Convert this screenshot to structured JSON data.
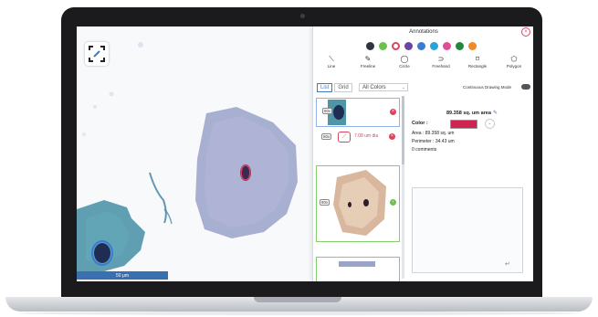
{
  "panel": {
    "title": "Annotations",
    "close_icon": "close-icon"
  },
  "palette": [
    "#2e3440",
    "#6cc24a",
    "#d9455f",
    "#6a45a6",
    "#3a7bd5",
    "#2aa3d8",
    "#e04e9a",
    "#1f8a3c",
    "#f08a24"
  ],
  "tools": [
    {
      "label": "Line",
      "icon": "line-icon",
      "glyph": "⟍"
    },
    {
      "label": "Freeline",
      "icon": "pencil-icon",
      "glyph": "✎"
    },
    {
      "label": "Circle",
      "icon": "circle-icon",
      "glyph": "◯"
    },
    {
      "label": "Freehand",
      "icon": "freehand-icon",
      "glyph": "⊃"
    },
    {
      "label": "Rectangle",
      "icon": "rectangle-icon",
      "glyph": "⌑"
    },
    {
      "label": "Polygon",
      "icon": "polygon-icon",
      "glyph": "⬠"
    }
  ],
  "view": {
    "list_label": "List",
    "grid_label": "Grid",
    "filter": "All Colors",
    "continuous_label": "Continuous Drawing Mode"
  },
  "list": {
    "items": [
      {
        "zoom": "80x"
      },
      {
        "zoom": "80x",
        "measure": "7.08 um dia"
      },
      {
        "zoom": "80x"
      }
    ]
  },
  "detail": {
    "area_title": "89.358 sq. um area",
    "color_label": "Color :",
    "color": "#cf2452",
    "area": "Area : 89.358 sq. um",
    "perimeter": "Perimeter : 34.43 um",
    "comments": "0 comments"
  },
  "viewer": {
    "scale": "50 μm"
  }
}
